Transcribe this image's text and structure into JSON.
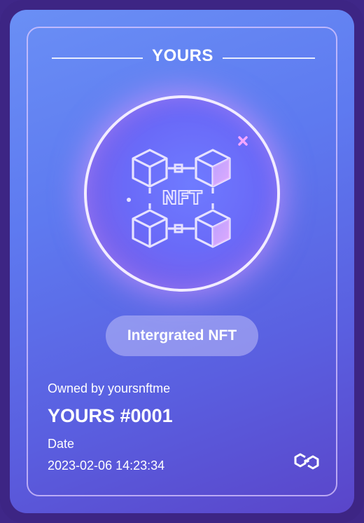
{
  "card": {
    "brand": "YOURS",
    "emblem_icon": "nft-blocks-icon",
    "emblem_text": "NFT",
    "badge": "Intergrated NFT",
    "owner_line": "Owned by yoursnftme",
    "token_name": "YOURS #0001",
    "date_label": "Date",
    "date_value": "2023-02-06 14:23:34",
    "chain_icon": "polygon-chain-icon"
  },
  "colors": {
    "outer": "#3d2584",
    "gradient_top": "#6a8ff5",
    "gradient_bottom": "#5a45c9",
    "frame": "#dcc8ff",
    "accent_pink": "#f3a6ff",
    "text": "#ffffff"
  }
}
